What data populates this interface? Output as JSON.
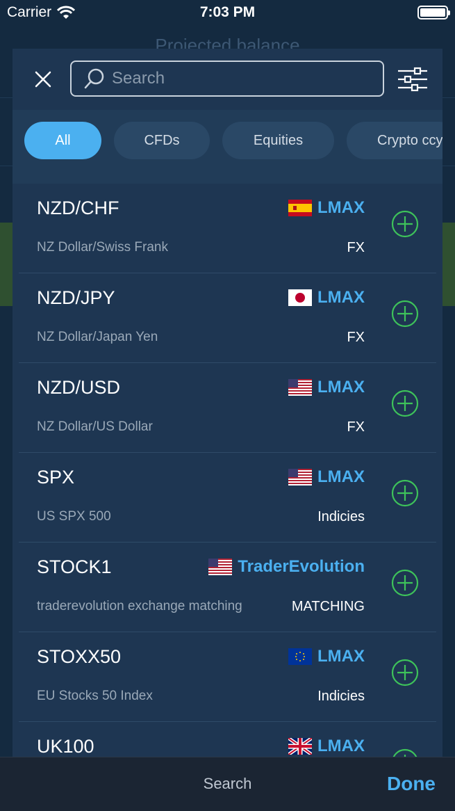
{
  "status_bar": {
    "carrier": "Carrier",
    "time": "7:03 PM"
  },
  "background": {
    "title": "Projected balance"
  },
  "search": {
    "placeholder": "Search"
  },
  "chips": [
    {
      "label": "All",
      "active": true
    },
    {
      "label": "CFDs",
      "active": false
    },
    {
      "label": "Equities",
      "active": false
    },
    {
      "label": "Crypto ccy",
      "active": false
    }
  ],
  "instruments": [
    {
      "symbol": "NZD/CHF",
      "description": "NZ Dollar/Swiss Frank",
      "exchange": "LMAX",
      "flag": "spain-flag-icon",
      "type": "FX"
    },
    {
      "symbol": "NZD/JPY",
      "description": "NZ Dollar/Japan Yen",
      "exchange": "LMAX",
      "flag": "japan-flag-icon",
      "type": "FX"
    },
    {
      "symbol": "NZD/USD",
      "description": "NZ Dollar/US Dollar",
      "exchange": "LMAX",
      "flag": "usa-flag-icon",
      "type": "FX"
    },
    {
      "symbol": "SPX",
      "description": "US SPX 500",
      "exchange": "LMAX",
      "flag": "usa-flag-icon",
      "type": "Indicies"
    },
    {
      "symbol": "STOCK1",
      "description": "traderevolution exchange matching",
      "exchange": "TraderEvolution",
      "flag": "usa-flag-icon",
      "type": "MATCHING"
    },
    {
      "symbol": "STOXX50",
      "description": "EU Stocks 50 Index",
      "exchange": "LMAX",
      "flag": "eu-flag-icon",
      "type": "Indicies"
    },
    {
      "symbol": "UK100",
      "description": "",
      "exchange": "LMAX",
      "flag": "uk-flag-icon",
      "type": ""
    }
  ],
  "bottom_bar": {
    "title": "Search",
    "done_label": "Done"
  },
  "colors": {
    "accent": "#4bb0f0",
    "add_green": "#3ec35a",
    "modal_bg": "#1e3652"
  }
}
